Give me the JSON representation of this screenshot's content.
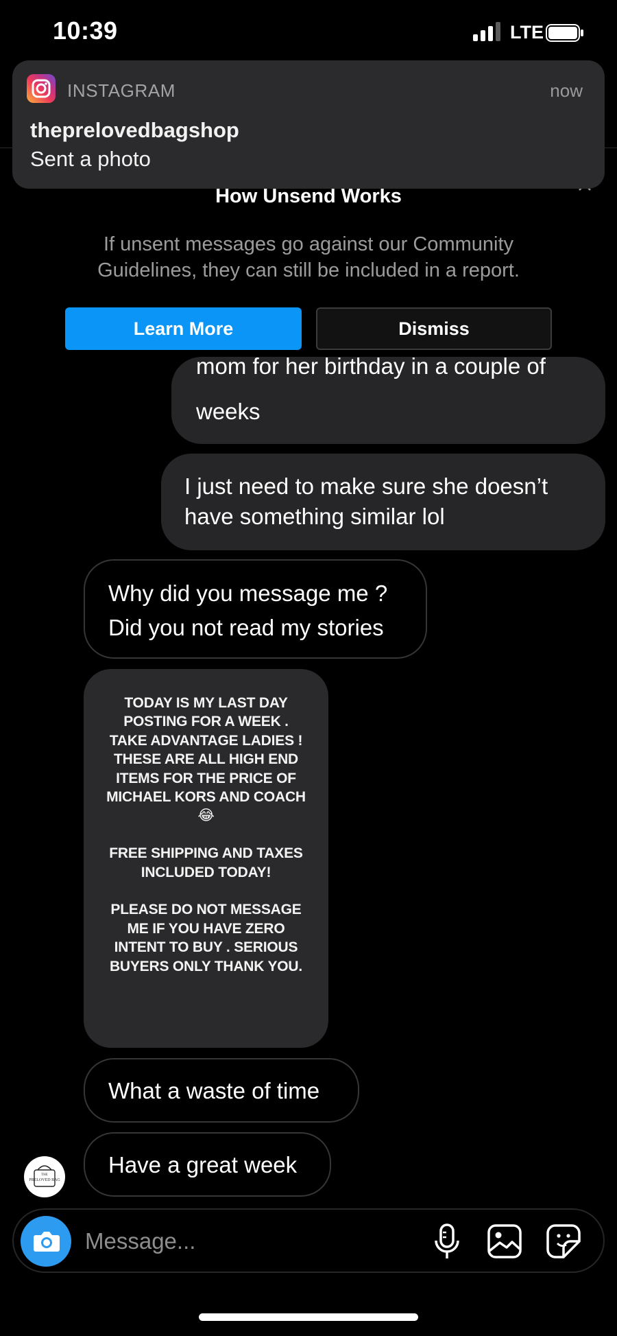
{
  "status_bar": {
    "time": "10:39",
    "network": "LTE"
  },
  "notification": {
    "app": "INSTAGRAM",
    "time": "now",
    "title": "theprelovedbagshop",
    "body": "Sent a photo"
  },
  "unsend_banner": {
    "title": "How Unsend Works",
    "description": "If unsent messages go against our Community Guidelines, they can still be included in a report.",
    "learn_more_label": "Learn More",
    "dismiss_label": "Dismiss"
  },
  "messages": [
    {
      "direction": "sent",
      "partial_line": "mom for her birthday in a couple of",
      "text": "weeks"
    },
    {
      "direction": "sent",
      "text": "I just need to make sure she doesn’t have something similar lol"
    },
    {
      "direction": "received",
      "text": "Why did you message me ? Did you not read my stories"
    },
    {
      "direction": "received",
      "type": "story_reply",
      "text": "TODAY IS MY LAST DAY\nPOSTING FOR A WEEK .\nTAKE ADVANTAGE LADIES !\nTHESE ARE ALL HIGH END\nITEMS FOR THE PRICE OF\nMICHAEL KORS AND COACH\n😂\n\nFREE SHIPPING AND TAXES\nINCLUDED TODAY!\n\nPLEASE DO NOT MESSAGE\nME IF YOU HAVE ZERO\nINTENT TO BUY . SERIOUS\nBUYERS ONLY THANK YOU."
    },
    {
      "direction": "received",
      "text": "What a waste of time"
    },
    {
      "direction": "received",
      "text": "Have a great week"
    }
  ],
  "avatar": {
    "text_top": "THE",
    "text_main": "PRELOVED BAG"
  },
  "composer": {
    "placeholder": "Message...",
    "icons": [
      "camera-icon",
      "microphone-icon",
      "gallery-icon",
      "sticker-icon"
    ]
  },
  "colors": {
    "accent": "#0a95f7",
    "camera": "#2d9bf0",
    "bubble_sent": "#262628"
  }
}
